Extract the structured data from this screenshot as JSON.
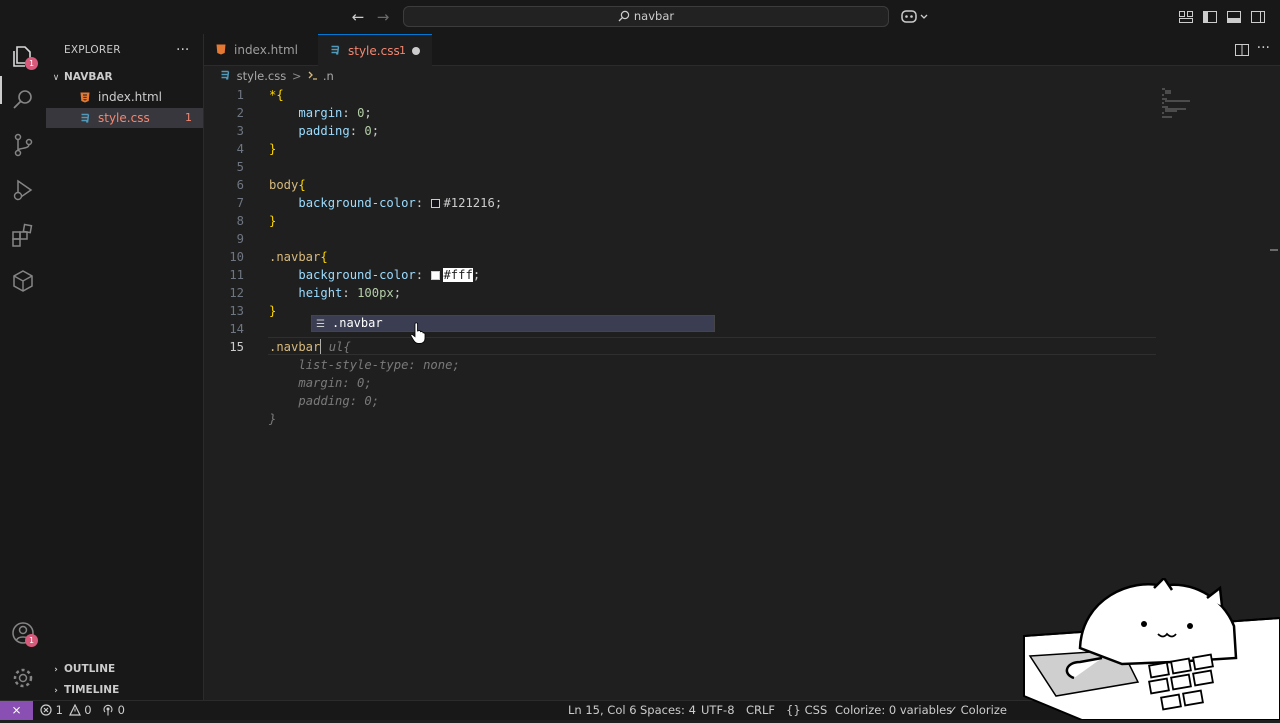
{
  "titlebar": {
    "back_icon": "arrow-left-icon",
    "forward_icon": "arrow-right-icon",
    "search_text": "navbar"
  },
  "activity": {
    "explorer_badge": "1",
    "accounts_badge": "1"
  },
  "sidebar": {
    "title": "EXPLORER",
    "more": "···",
    "folder": "NAVBAR",
    "files": [
      {
        "name": "index.html",
        "icon": "html5-icon",
        "color": "#e37933",
        "badge": ""
      },
      {
        "name": "style.css",
        "icon": "css3-icon",
        "color": "#519aba",
        "badge": "1"
      }
    ],
    "outline_label": "OUTLINE",
    "timeline_label": "TIMELINE"
  },
  "tabs": [
    {
      "label": "index.html",
      "active": false
    },
    {
      "label": "style.css",
      "active": true,
      "problems": "1",
      "dirty": true
    }
  ],
  "breadcrumb": {
    "file": "style.css",
    "separator": ">",
    "symbol": ".n"
  },
  "editor": {
    "line_numbers": [
      "1",
      "2",
      "3",
      "4",
      "5",
      "6",
      "7",
      "8",
      "9",
      "10",
      "11",
      "12",
      "13",
      "14",
      "15"
    ],
    "current_line": "15",
    "lines": {
      "l1": "*{",
      "l2_prop": "margin",
      "l2_val": "0",
      "l3_prop": "padding",
      "l3_val": "0",
      "l4": "}",
      "l6_sel": "body",
      "l6_brace": "{",
      "l7_prop": "background-color",
      "l7_val": "#121216",
      "l8": "}",
      "l10_sel": ".navbar",
      "l10_brace": "{",
      "l11_prop": "background-color",
      "l11_val": "#fff",
      "l12_prop": "height",
      "l12_val": "100px",
      "l13": "}",
      "l15_typed": ".navbar",
      "l15_ghost": " ul{",
      "ghost1": "list-style-type: none;",
      "ghost2": "margin: 0;",
      "ghost3": "padding: 0;",
      "ghost4": "}"
    },
    "swatch_colors": [
      "#121216",
      "#ffffff"
    ]
  },
  "suggest": {
    "icon": "symbol-keyword-icon",
    "item": ".navbar"
  },
  "statusbar": {
    "errors": "1",
    "warnings": "0",
    "ports": "0",
    "position": "Ln 15, Col 6",
    "spaces": "Spaces: 4",
    "encoding": "UTF-8",
    "eol": "CRLF",
    "language": "CSS",
    "colorize_vars": "Colorize: 0 variables",
    "colorize": "Colorize"
  },
  "colors": {
    "accent": "#0078d4",
    "tab_modified": "#f48771",
    "selector": "#d7ba7d",
    "property": "#9cdcfe",
    "number": "#b5cea8",
    "remote": "#8a4fb2"
  }
}
